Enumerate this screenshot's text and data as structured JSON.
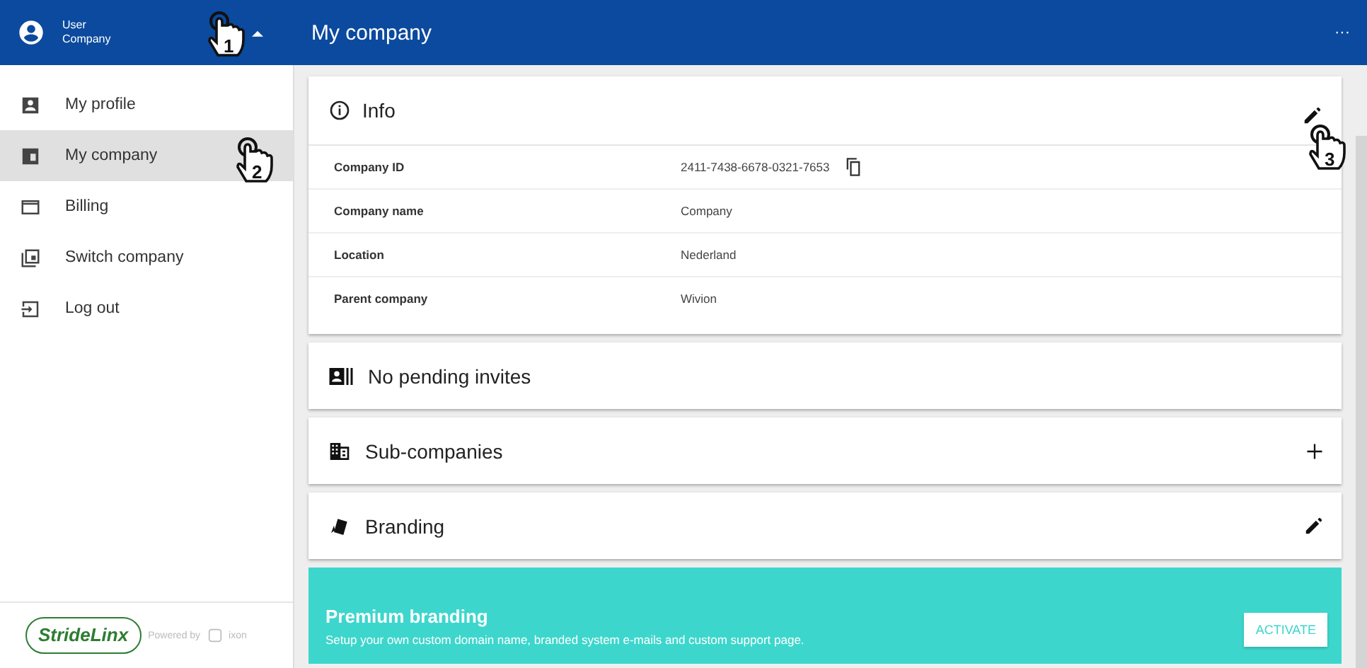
{
  "header": {
    "user_name": "User",
    "company_name": "Company",
    "title": "My company",
    "more": "···"
  },
  "sidebar": {
    "items": [
      {
        "kind": "profile",
        "label": "My profile",
        "selected": false
      },
      {
        "kind": "company",
        "label": "My company",
        "selected": true
      },
      {
        "kind": "billing",
        "label": "Billing",
        "selected": false
      },
      {
        "kind": "switch",
        "label": "Switch company",
        "selected": false
      },
      {
        "kind": "logout",
        "label": "Log out",
        "selected": false
      }
    ],
    "footer": {
      "logo": "StrideLinx",
      "powered_by": "Powered by",
      "brand": "ixon"
    }
  },
  "info": {
    "title": "Info",
    "rows": [
      {
        "label": "Company ID",
        "value": "2411-7438-6678-0321-7653",
        "copyable": true
      },
      {
        "label": "Company name",
        "value": "Company",
        "copyable": false
      },
      {
        "label": "Location",
        "value": "Nederland",
        "copyable": false
      },
      {
        "label": "Parent company",
        "value": "Wivion",
        "copyable": false
      }
    ]
  },
  "sections": [
    {
      "kind": "invites",
      "title": "No pending invites",
      "addable": false,
      "editable": false
    },
    {
      "kind": "subcompanies",
      "title": "Sub-companies",
      "addable": true,
      "editable": false
    },
    {
      "kind": "branding",
      "title": "Branding",
      "addable": false,
      "editable": true
    }
  ],
  "premium": {
    "title": "Premium branding",
    "text": "Setup your own custom domain name, branded system e-mails and custom support page.",
    "button": "ACTIVATE"
  },
  "callouts": [
    "1",
    "2",
    "3"
  ]
}
